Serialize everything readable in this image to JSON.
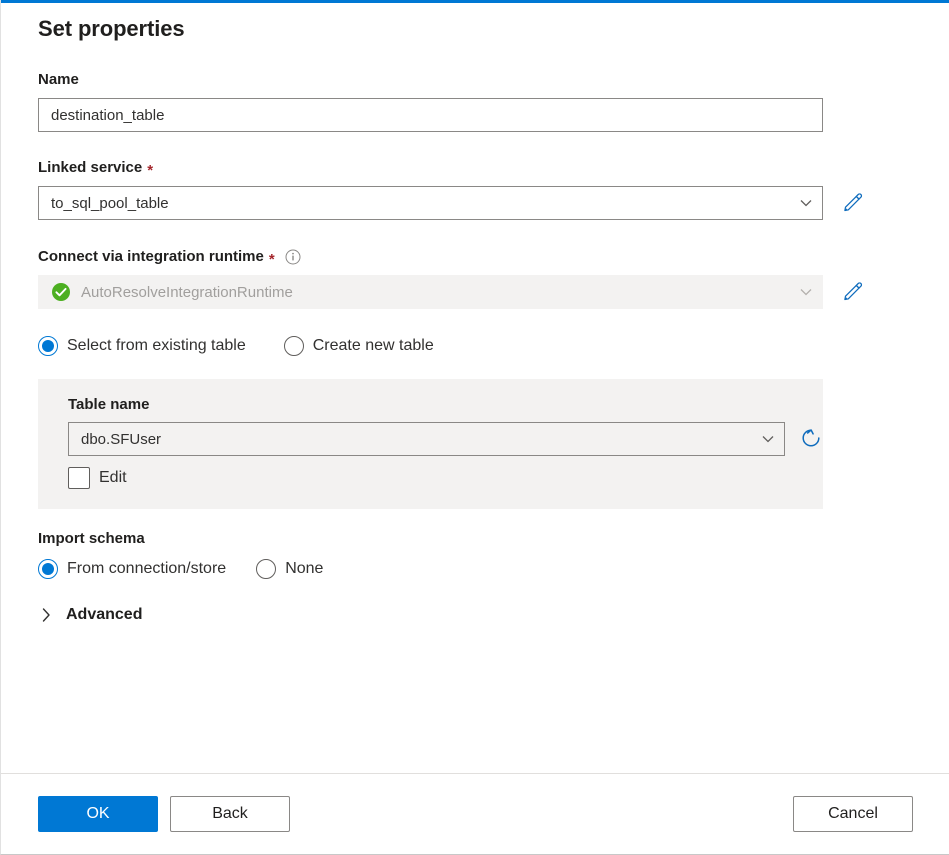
{
  "dialog": {
    "title": "Set properties",
    "accent_color": "#0078d4"
  },
  "fields": {
    "name": {
      "label": "Name",
      "value": "destination_table"
    },
    "linked_service": {
      "label": "Linked service",
      "required_marker": "*",
      "value": "to_sql_pool_table",
      "edit_icon": "pencil-icon",
      "chevron_icon": "chevron-down-icon"
    },
    "integration_runtime": {
      "label": "Connect via integration runtime",
      "required_marker": "*",
      "info_icon": "info-icon",
      "value": "AutoResolveIntegrationRuntime",
      "status_icon": "green-check-icon",
      "status_color": "#4caf21",
      "disabled": true,
      "edit_icon": "pencil-icon",
      "chevron_icon": "chevron-down-icon"
    }
  },
  "table_mode": {
    "options": [
      {
        "label": "Select from existing table",
        "selected": true
      },
      {
        "label": "Create new table",
        "selected": false
      }
    ]
  },
  "table_panel": {
    "label": "Table name",
    "value": "dbo.SFUser",
    "chevron_icon": "chevron-down-icon",
    "refresh_icon": "refresh-icon",
    "refresh_color": "#0078d4",
    "edit_checkbox": {
      "label": "Edit",
      "checked": false
    }
  },
  "import_schema": {
    "label": "Import schema",
    "options": [
      {
        "label": "From connection/store",
        "selected": true
      },
      {
        "label": "None",
        "selected": false
      }
    ]
  },
  "advanced": {
    "label": "Advanced",
    "expanded": false,
    "chevron_icon": "chevron-right-icon"
  },
  "footer": {
    "ok_label": "OK",
    "back_label": "Back",
    "cancel_label": "Cancel",
    "primary_color": "#0078d4"
  }
}
